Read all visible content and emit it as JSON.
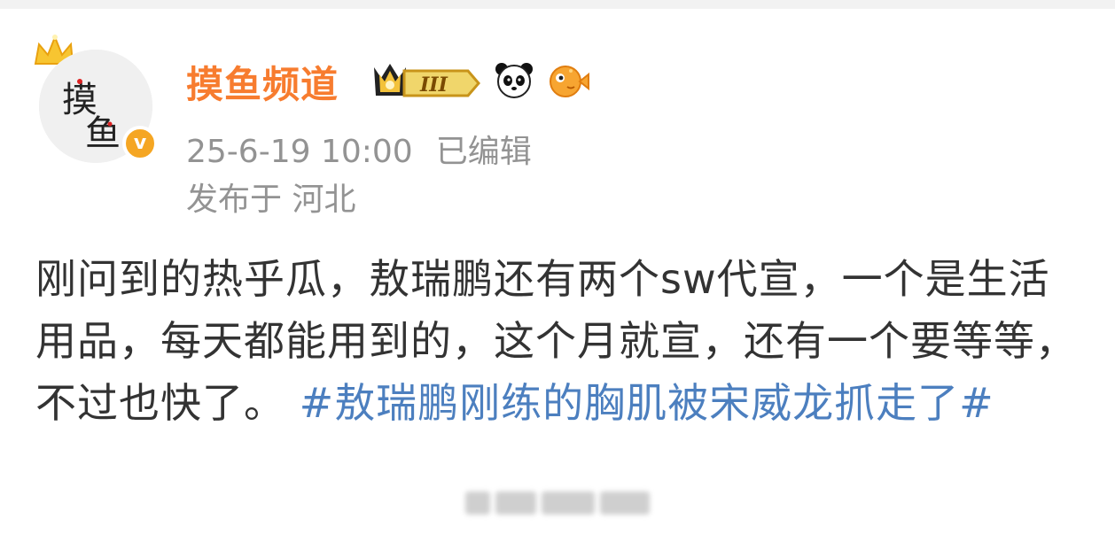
{
  "post": {
    "author": "摸鱼频道",
    "level_badge": "III",
    "timestamp": "25-6-19 10:00",
    "edited": "已编辑",
    "location": "发布于 河北",
    "text": "刚问到的热乎瓜，敖瑞鹏还有两个sw代宣，一个是生活用品，每天都能用到的，这个月就宣，还有一个要等等，不过也快了。",
    "hashtag": "#敖瑞鹏刚练的胸肌被宋威龙抓走了#"
  },
  "icons": [
    "crown-icon",
    "level-badge-icon",
    "panda-icon",
    "pufferfish-icon",
    "verified-icon"
  ],
  "colors": {
    "author_name": "#f77c2f",
    "meta_text": "#939393",
    "body_text": "#333333",
    "hashtag": "#4c7fbf",
    "verified": "#f5a623"
  }
}
